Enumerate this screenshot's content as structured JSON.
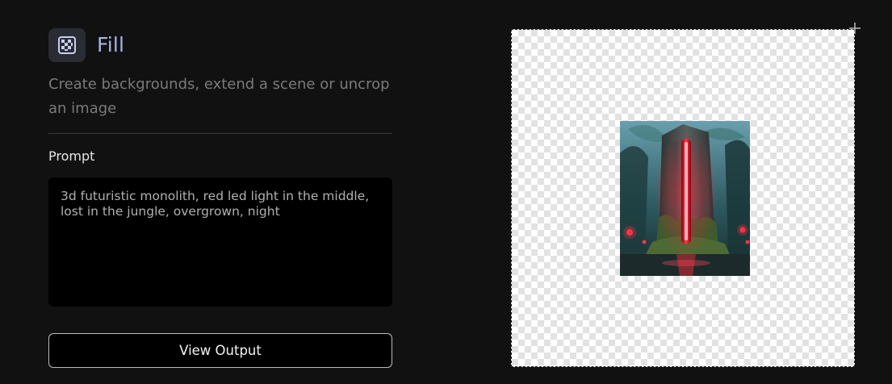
{
  "tool": {
    "icon": "checker-grid-icon",
    "title": "Fill",
    "description": "Create backgrounds, extend a scene or uncrop an image"
  },
  "prompt": {
    "label": "Prompt",
    "value": "3d futuristic monolith, red led light in the middle, lost in the jungle, overgrown, night"
  },
  "actions": {
    "view_output_label": "View Output"
  },
  "canvas": {
    "background": "transparent-checkerboard",
    "image_subject": "jungle-monolith-red-light"
  },
  "colors": {
    "accent": "#a9b3e3",
    "panel_bg": "#111111",
    "input_bg": "#000000"
  }
}
